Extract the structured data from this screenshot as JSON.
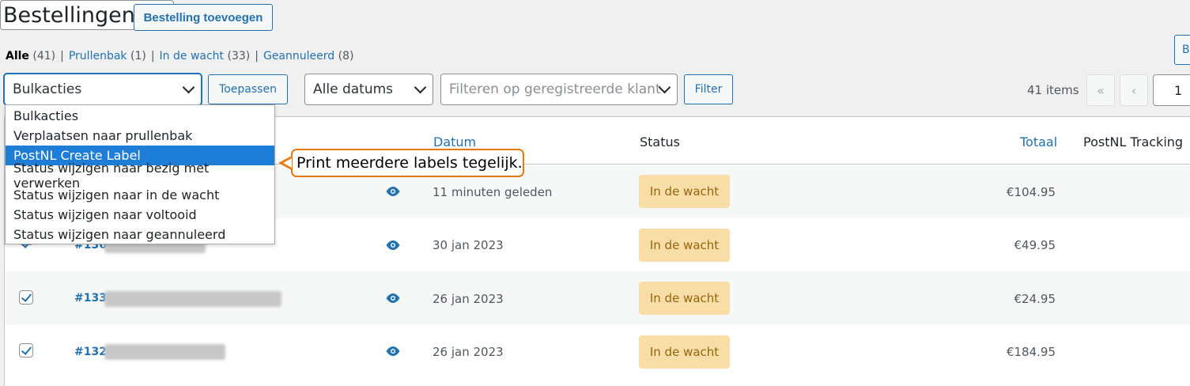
{
  "header": {
    "title": "Bestellingen",
    "add_button": "Bestelling toevoegen"
  },
  "views": [
    {
      "label": "Alle",
      "count": "(41)"
    },
    {
      "label": "Prullenbak",
      "count": "(1)"
    },
    {
      "label": "In de wacht",
      "count": "(33)"
    },
    {
      "label": "Geannuleerd",
      "count": "(8)"
    }
  ],
  "search": {
    "button_label": "B"
  },
  "filters": {
    "bulk_selected": "Bulkacties",
    "apply_label": "Toepassen",
    "date_selected": "Alle datums",
    "customer_placeholder": "Filteren op geregistreerde klant",
    "filter_label": "Filter"
  },
  "pagination": {
    "items": "41 items",
    "first": "«",
    "prev": "‹",
    "current": "1"
  },
  "table": {
    "columns": {
      "date": "Datum",
      "status": "Status",
      "total": "Totaal",
      "tracking": "PostNL Tracking"
    },
    "rows": [
      {
        "order": "",
        "date": "11 minuten geleden",
        "status": "In de wacht",
        "total": "€104.95"
      },
      {
        "order": "#136",
        "date": "30 jan 2023",
        "status": "In de wacht",
        "total": "€49.95"
      },
      {
        "order": "#133",
        "date": "26 jan 2023",
        "status": "In de wacht",
        "total": "€24.95"
      },
      {
        "order": "#132",
        "date": "26 jan 2023",
        "status": "In de wacht",
        "total": "€184.95"
      }
    ]
  },
  "bulk_dropdown": {
    "options": [
      "Bulkacties",
      "Verplaatsen naar prullenbak",
      "PostNL Create Label",
      "Status wijzigen naar bezig met verwerken",
      "Status wijzigen naar in de wacht",
      "Status wijzigen naar voltooid",
      "Status wijzigen naar geannuleerd"
    ],
    "highlighted": "PostNL Create Label"
  },
  "callout": {
    "text": "Print meerdere labels tegelijk."
  },
  "colors": {
    "accent": "#2271b1",
    "status_bg": "#f8dda7",
    "status_text": "#94660c",
    "dropdown_highlight": "#1e7dd7",
    "callout_border": "#e8780f"
  },
  "icons": {
    "view": "eye-icon",
    "select": "chevron-down-icon"
  }
}
